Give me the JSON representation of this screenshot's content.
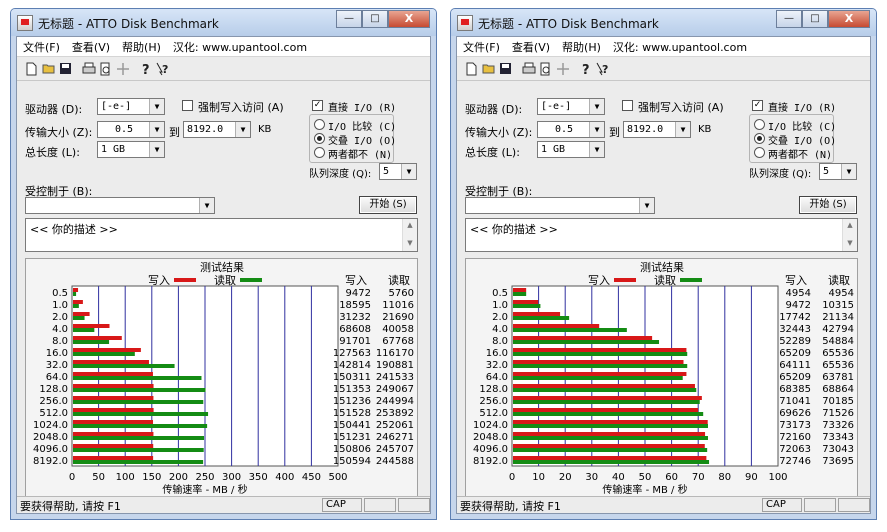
{
  "windows": [
    {
      "title": "无标题 - ATTO Disk Benchmark",
      "title_buttons": {
        "minimize": "—",
        "maximize": "□",
        "close": "X"
      },
      "menu": [
        "文件(F)",
        "查看(V)",
        "帮助(H)",
        "汉化: www.upantool.com"
      ],
      "toolbar_icons": [
        "new-file-icon",
        "open-folder-icon",
        "save-icon",
        "print-icon",
        "print-preview-icon",
        "move-icon",
        "help-icon",
        "context-help-icon"
      ],
      "form": {
        "drive_label": "驱动器 (D):",
        "drive_value": "[-e-]",
        "force_write_label": "强制写入访问 (A)",
        "force_write_checked": false,
        "direct_io_label": "直接 I/O (R)",
        "direct_io_checked": true,
        "transfer_label": "传输大小 (Z):",
        "transfer_from": "0.5",
        "transfer_to_label": "到",
        "transfer_to": "8192.0",
        "transfer_unit": "KB",
        "total_length_label": "总长度 (L):",
        "total_length": "1 GB",
        "io_options": [
          "I/O 比较 (C)",
          "交叠 I/O (O)",
          "两者都不 (N)"
        ],
        "io_selected": 1,
        "queue_label": "队列深度 (Q):",
        "queue_value": "5",
        "controlled_label": "受控制于 (B):",
        "controlled_value": "",
        "start_button": "开始 (S)",
        "description": "<<  你的描述   >>"
      },
      "results": {
        "title": "测试结果",
        "write_legend": "写入",
        "read_legend": "读取",
        "col_write": "写入",
        "col_read": "读取"
      },
      "chart_data": {
        "type": "bar",
        "title": "测试结果",
        "xlabel": "传输速率 - MB / 秒",
        "xlim": [
          0,
          500
        ],
        "xticks": [
          "0",
          "50",
          "100",
          "150",
          "200",
          "250",
          "300",
          "350",
          "400",
          "450",
          "500"
        ],
        "categories": [
          "0.5",
          "1.0",
          "2.0",
          "4.0",
          "8.0",
          "16.0",
          "32.0",
          "64.0",
          "128.0",
          "256.0",
          "512.0",
          "1024.0",
          "2048.0",
          "4096.0",
          "8192.0"
        ],
        "series": [
          {
            "name": "写入",
            "color": "#d81818",
            "values": [
              9.5,
              18.6,
              31.2,
              68.6,
              91.7,
              127.6,
              142.8,
              150.3,
              151.4,
              151.2,
              151.5,
              150.4,
              151.2,
              150.8,
              150.6
            ]
          },
          {
            "name": "读取",
            "color": "#148c14",
            "values": [
              5.8,
              11.0,
              21.7,
              40.1,
              67.8,
              116.2,
              190.9,
              241.5,
              249.1,
              244.9,
              253.9,
              252.1,
              246.3,
              245.7,
              244.6
            ]
          }
        ],
        "write_numbers": [
          "9472",
          "18595",
          "31232",
          "68608",
          "91701",
          "127563",
          "142814",
          "150311",
          "151353",
          "151236",
          "151528",
          "150441",
          "151231",
          "150806",
          "150594"
        ],
        "read_numbers": [
          "5760",
          "11016",
          "21690",
          "40058",
          "67768",
          "116170",
          "190881",
          "241533",
          "249067",
          "244994",
          "253892",
          "252061",
          "246271",
          "245707",
          "244588"
        ]
      },
      "status": {
        "text": "要获得帮助, 请按 F1",
        "cap": "CAP"
      }
    },
    {
      "title": "无标题 - ATTO Disk Benchmark",
      "title_buttons": {
        "minimize": "—",
        "maximize": "□",
        "close": "X"
      },
      "menu": [
        "文件(F)",
        "查看(V)",
        "帮助(H)",
        "汉化: www.upantool.com"
      ],
      "toolbar_icons": [
        "new-file-icon",
        "open-folder-icon",
        "save-icon",
        "print-icon",
        "print-preview-icon",
        "move-icon",
        "help-icon",
        "context-help-icon"
      ],
      "form": {
        "drive_label": "驱动器 (D):",
        "drive_value": "[-e-]",
        "force_write_label": "强制写入访问 (A)",
        "force_write_checked": false,
        "direct_io_label": "直接 I/O (R)",
        "direct_io_checked": true,
        "transfer_label": "传输大小 (Z):",
        "transfer_from": "0.5",
        "transfer_to_label": "到",
        "transfer_to": "8192.0",
        "transfer_unit": "KB",
        "total_length_label": "总长度 (L):",
        "total_length": "1 GB",
        "io_options": [
          "I/O 比较 (C)",
          "交叠 I/O (O)",
          "两者都不 (N)"
        ],
        "io_selected": 1,
        "queue_label": "队列深度 (Q):",
        "queue_value": "5",
        "controlled_label": "受控制于 (B):",
        "controlled_value": "",
        "start_button": "开始 (S)",
        "description": "<<  你的描述   >>"
      },
      "results": {
        "title": "测试结果",
        "write_legend": "写入",
        "read_legend": "读取",
        "col_write": "写入",
        "col_read": "读取"
      },
      "chart_data": {
        "type": "bar",
        "title": "测试结果",
        "xlabel": "传输速率 - MB / 秒",
        "xlim": [
          0,
          100
        ],
        "xticks": [
          "0",
          "10",
          "20",
          "30",
          "40",
          "50",
          "60",
          "70",
          "80",
          "90",
          "100"
        ],
        "categories": [
          "0.5",
          "1.0",
          "2.0",
          "4.0",
          "8.0",
          "16.0",
          "32.0",
          "64.0",
          "128.0",
          "256.0",
          "512.0",
          "1024.0",
          "2048.0",
          "4096.0",
          "8192.0"
        ],
        "series": [
          {
            "name": "写入",
            "color": "#d81818",
            "values": [
              4.95,
              9.47,
              17.7,
              32.4,
              52.3,
              65.2,
              64.1,
              65.2,
              68.4,
              71.0,
              69.6,
              73.2,
              72.2,
              72.1,
              72.7
            ]
          },
          {
            "name": "读取",
            "color": "#148c14",
            "values": [
              4.95,
              10.3,
              21.1,
              42.8,
              54.9,
              65.5,
              65.5,
              63.8,
              68.9,
              70.2,
              71.5,
              73.3,
              73.3,
              73.0,
              73.7
            ]
          }
        ],
        "write_numbers": [
          "4954",
          "9472",
          "17742",
          "32443",
          "52289",
          "65209",
          "64111",
          "65209",
          "68385",
          "71041",
          "69626",
          "73173",
          "72160",
          "72063",
          "72746"
        ],
        "read_numbers": [
          "4954",
          "10315",
          "21134",
          "42794",
          "54884",
          "65536",
          "65536",
          "63781",
          "68864",
          "70185",
          "71526",
          "73326",
          "73343",
          "73043",
          "73695"
        ]
      },
      "status": {
        "text": "要获得帮助, 请按 F1",
        "cap": "CAP"
      }
    }
  ]
}
